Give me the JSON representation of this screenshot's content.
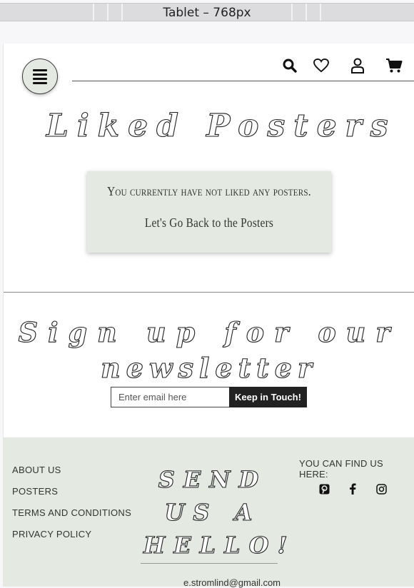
{
  "device_bar": {
    "label": "Tablet – 768px"
  },
  "header": {
    "icons": [
      "search-icon",
      "heart-icon",
      "user-icon",
      "cart-icon"
    ]
  },
  "main": {
    "title": "Liked Posters",
    "message": "You currently have not liked any posters.",
    "back_link": "Let's Go Back to the Posters"
  },
  "newsletter": {
    "title_line1": "Sign up for our",
    "title_line2": "newsletter",
    "placeholder": "Enter email here",
    "button_label": "Keep in Touch!"
  },
  "footer": {
    "links": [
      "ABOUT US",
      "POSTERS",
      "TERMS AND CONDITIONS",
      "PRIVACY POLICY"
    ],
    "hello_line1": "SEND",
    "hello_line2": "US A",
    "hello_line3": "HELLO!",
    "email": "e.stromlind@gmail.com",
    "find_us": "YOU CAN FIND US HERE:",
    "social_icons": [
      "pinterest-icon",
      "facebook-icon",
      "instagram-icon"
    ]
  },
  "colors": {
    "accent_bg": "#e4eae2",
    "dark": "#222222"
  }
}
